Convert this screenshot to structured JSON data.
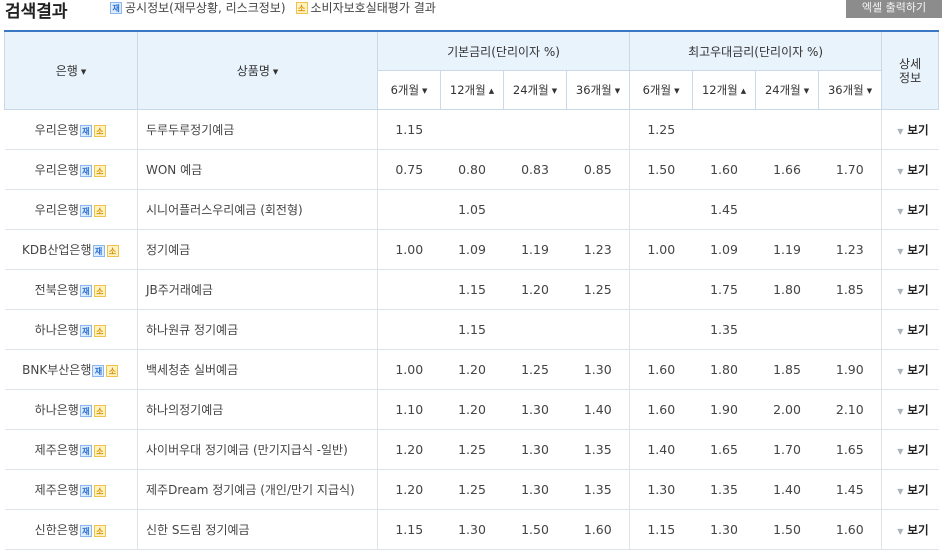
{
  "header": {
    "title": "검색결과",
    "legend": [
      {
        "badge": "재",
        "label": "공시정보(재무상황, 리스크정보)"
      },
      {
        "badge": "소",
        "label": "소비자보호실태평가 결과"
      }
    ],
    "excel_button": "엑셀 출력하기"
  },
  "table": {
    "col_bank": "은행",
    "col_product": "상품명",
    "group_basic": "기본금리(단리이자 %)",
    "group_max": "최고우대금리(단리이자 %)",
    "col_detail": "상세\n정보",
    "terms": [
      "6개월",
      "12개월",
      "24개월",
      "36개월"
    ],
    "term_arrows": [
      "▼",
      "▲",
      "▼",
      "▼"
    ],
    "detail_label": "보기",
    "badges": {
      "j": "재",
      "s": "소"
    },
    "rows": [
      {
        "bank": "우리은행",
        "product": "두루두루정기예금",
        "basic": [
          "1.15",
          "",
          "",
          ""
        ],
        "max": [
          "1.25",
          "",
          "",
          ""
        ]
      },
      {
        "bank": "우리은행",
        "product": "WON 예금",
        "basic": [
          "0.75",
          "0.80",
          "0.83",
          "0.85"
        ],
        "max": [
          "1.50",
          "1.60",
          "1.66",
          "1.70"
        ]
      },
      {
        "bank": "우리은행",
        "product": "시니어플러스우리예금 (회전형)",
        "basic": [
          "",
          "1.05",
          "",
          ""
        ],
        "max": [
          "",
          "1.45",
          "",
          ""
        ]
      },
      {
        "bank": "KDB산업은행",
        "product": "정기예금",
        "basic": [
          "1.00",
          "1.09",
          "1.19",
          "1.23"
        ],
        "max": [
          "1.00",
          "1.09",
          "1.19",
          "1.23"
        ]
      },
      {
        "bank": "전북은행",
        "product": "JB주거래예금",
        "basic": [
          "",
          "1.15",
          "1.20",
          "1.25"
        ],
        "max": [
          "",
          "1.75",
          "1.80",
          "1.85"
        ]
      },
      {
        "bank": "하나은행",
        "product": "하나원큐 정기예금",
        "basic": [
          "",
          "1.15",
          "",
          ""
        ],
        "max": [
          "",
          "1.35",
          "",
          ""
        ]
      },
      {
        "bank": "BNK부산은행",
        "product": "백세청춘 실버예금",
        "basic": [
          "1.00",
          "1.20",
          "1.25",
          "1.30"
        ],
        "max": [
          "1.60",
          "1.80",
          "1.85",
          "1.90"
        ]
      },
      {
        "bank": "하나은행",
        "product": "하나의정기예금",
        "basic": [
          "1.10",
          "1.20",
          "1.30",
          "1.40"
        ],
        "max": [
          "1.60",
          "1.90",
          "2.00",
          "2.10"
        ]
      },
      {
        "bank": "제주은행",
        "product": "사이버우대 정기예금 (만기지급식 -일반)",
        "basic": [
          "1.20",
          "1.25",
          "1.30",
          "1.35"
        ],
        "max": [
          "1.40",
          "1.65",
          "1.70",
          "1.65"
        ]
      },
      {
        "bank": "제주은행",
        "product": "제주Dream 정기예금 (개인/만기 지급식)",
        "basic": [
          "1.20",
          "1.25",
          "1.30",
          "1.35"
        ],
        "max": [
          "1.30",
          "1.35",
          "1.40",
          "1.45"
        ]
      },
      {
        "bank": "신한은행",
        "product": "신한 S드림 정기예금",
        "basic": [
          "1.15",
          "1.30",
          "1.50",
          "1.60"
        ],
        "max": [
          "1.15",
          "1.30",
          "1.50",
          "1.60"
        ]
      }
    ]
  }
}
